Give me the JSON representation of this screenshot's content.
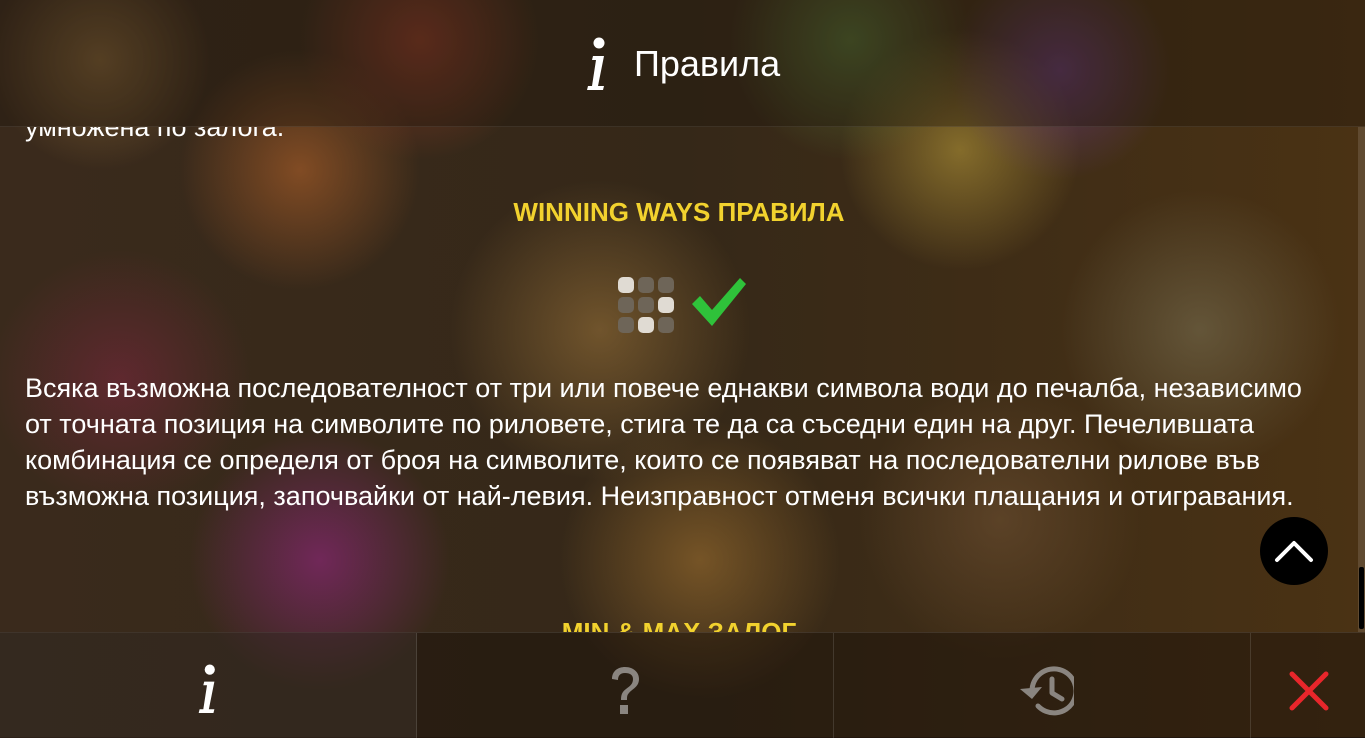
{
  "header": {
    "title": "Правила",
    "icon": "info-icon"
  },
  "content": {
    "clipped_text": "умножена по залога.",
    "winning_ways": {
      "title": "WINNING WAYS ПРАВИЛА",
      "text": "Всяка възможна последователност от три или повече еднакви символа води до печалба, независимо от точната позиция на символите по риловете, стига те да са съседни един на друг. Печелившата комбинация се определя от броя на символите, които се появяват на последователни рилове във възможна позиция, започвайки от най-левия. Неизправност отменя всички плащания и отигравания."
    },
    "next_section_title": "MIN & MAX ЗАЛОГ"
  },
  "footer": {
    "tabs": [
      {
        "icon": "info-icon",
        "active": true
      },
      {
        "icon": "question-mark-icon",
        "active": false
      },
      {
        "icon": "history-icon",
        "active": false
      },
      {
        "icon": "close-icon",
        "active": false
      }
    ]
  },
  "colors": {
    "section_title": "#f2d22e",
    "check": "#2fc23a",
    "close": "#e8262b",
    "footer_icon_inactive": "#8a8580"
  }
}
